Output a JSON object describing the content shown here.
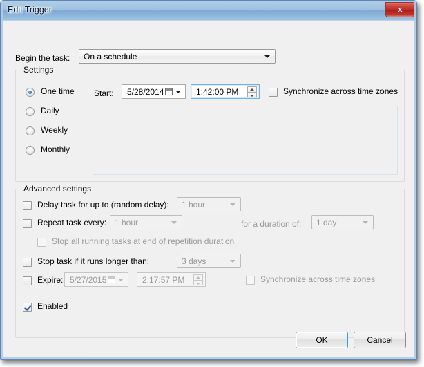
{
  "window": {
    "title": "Edit Trigger",
    "close_label": "x"
  },
  "begin": {
    "label": "Begin the task:",
    "value": "On a schedule"
  },
  "settings": {
    "group_title": "Settings",
    "schedule_options": [
      {
        "label": "One time",
        "selected": true
      },
      {
        "label": "Daily",
        "selected": false
      },
      {
        "label": "Weekly",
        "selected": false
      },
      {
        "label": "Monthly",
        "selected": false
      }
    ],
    "start_label": "Start:",
    "start_date": "5/28/2014",
    "start_time": "1:42:00 PM",
    "sync_timezones_label": "Synchronize across time zones",
    "sync_timezones_checked": false
  },
  "advanced": {
    "group_title": "Advanced settings",
    "delay": {
      "label": "Delay task for up to (random delay):",
      "checked": false,
      "value": "1 hour"
    },
    "repeat": {
      "label": "Repeat task every:",
      "checked": false,
      "value": "1 hour",
      "duration_label": "for a duration of:",
      "duration_value": "1 day"
    },
    "stop_at_end": {
      "label": "Stop all running tasks at end of repetition duration",
      "checked": false
    },
    "stop_longer": {
      "label": "Stop task if it runs longer than:",
      "checked": false,
      "value": "3 days"
    },
    "expire": {
      "label": "Expire:",
      "checked": false,
      "date": "5/27/2015",
      "time": "2:17:57 PM",
      "sync_timezones_label": "Synchronize across time zones",
      "sync_timezones_checked": false
    },
    "enabled": {
      "label": "Enabled",
      "checked": true
    }
  },
  "footer": {
    "ok_label": "OK",
    "cancel_label": "Cancel"
  }
}
